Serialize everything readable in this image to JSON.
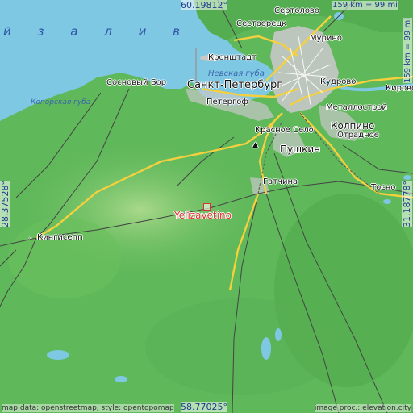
{
  "map": {
    "featured_place": "Yelizavetino",
    "colors": {
      "water": "#7ec8e3",
      "land": "#5fb85a",
      "land_light": "#9fd27a",
      "urban": "#c8c8c8",
      "road_major": "#f4d03f",
      "road_minor": "#555555",
      "featured": "#e0302c"
    },
    "water_labels": {
      "gulf": "й  з а л и в",
      "neva_bay": "Невская губа",
      "koporye_bay": "Копорская губа"
    },
    "places": [
      {
        "id": "sertolovo",
        "name": "Сертолово"
      },
      {
        "id": "sestroretsk",
        "name": "Сестрорецк"
      },
      {
        "id": "murino",
        "name": "Мурино"
      },
      {
        "id": "kronshtadt",
        "name": "Кронштадт"
      },
      {
        "id": "spb",
        "name": "Санкт-Петербург"
      },
      {
        "id": "kudrovo",
        "name": "Кудрово"
      },
      {
        "id": "kirovsk",
        "name": "Кировск"
      },
      {
        "id": "sosnovy_bor",
        "name": "Сосновый Бор"
      },
      {
        "id": "peterhof",
        "name": "Петергоф"
      },
      {
        "id": "metallostroy",
        "name": "Металлострой"
      },
      {
        "id": "krasnoe_selo",
        "name": "Красное Село"
      },
      {
        "id": "kolpino",
        "name": "Колпино"
      },
      {
        "id": "otradnoe",
        "name": "Отрадное"
      },
      {
        "id": "pushkin",
        "name": "Пушкин"
      },
      {
        "id": "gatchina",
        "name": "Гатчина"
      },
      {
        "id": "tosno",
        "name": "Тосно"
      },
      {
        "id": "kingisepp",
        "name": "Кингисепп"
      }
    ],
    "coords": {
      "top": "60.19812°",
      "bottom": "58.77025°",
      "left": "28.37528°",
      "right": "31.18778°"
    },
    "scale": {
      "horizontal": "159 km = 99 mi",
      "vertical": "159 km = 99 mi"
    },
    "credits": {
      "left": "map data: openstreetmap, style: opentopomap",
      "right": "image proc.: elevation.city"
    },
    "icons": [
      "town-marker-icon",
      "monument-icon"
    ]
  }
}
